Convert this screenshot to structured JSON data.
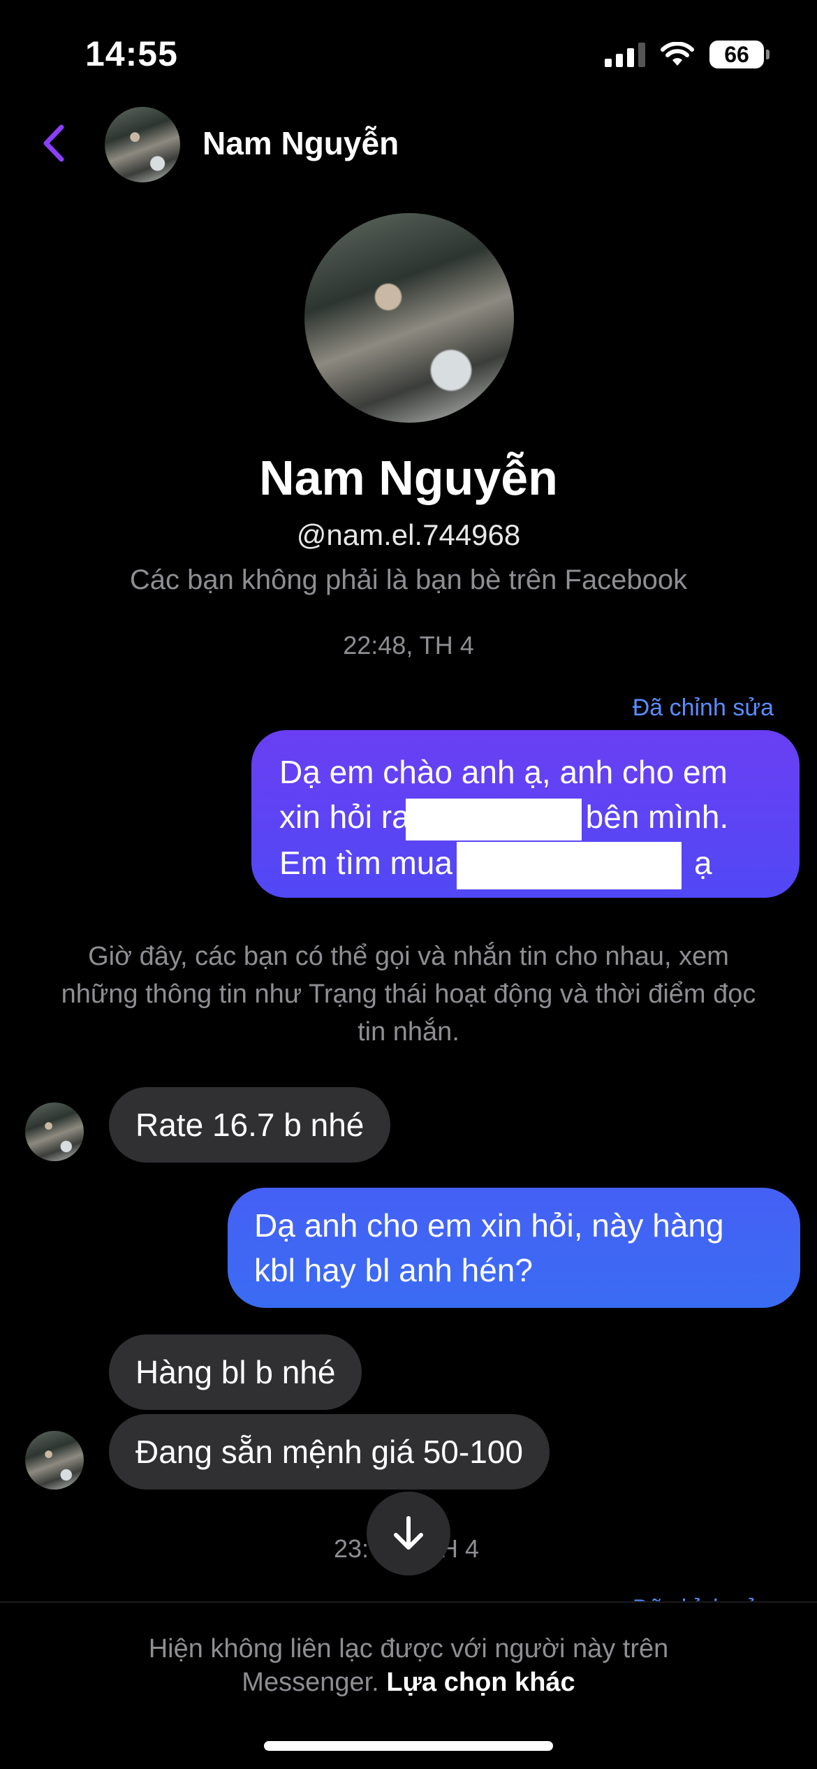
{
  "status_bar": {
    "time": "14:55",
    "battery": "66"
  },
  "header": {
    "name": "Nam Nguyễn",
    "back_icon": "chevron-left-icon"
  },
  "profile": {
    "name": "Nam Nguyễn",
    "handle": "@nam.el.744968",
    "note": "Các bạn không phải là bạn bè trên Facebook"
  },
  "conversation": {
    "timestamp_1": "22:48, TH 4",
    "edited_label": "Đã chỉnh sửa",
    "outgoing_1": {
      "line_1": "Dạ em chào anh ạ, anh cho em",
      "line_2_start": "xin hỏi ra",
      "line_2_end": "bên mình.",
      "line_3_start": "Em tìm mua",
      "line_3_end": "ạ"
    },
    "system_note": "Giờ đây, các bạn có thể gọi và nhắn tin cho nhau, xem những thông tin như Trạng thái hoạt động và thời điểm đọc tin nhắn.",
    "incoming_1": "Rate 16.7 b nhé",
    "outgoing_2": "Dạ anh cho em xin hỏi, này hàng kbl hay bl anh hén?",
    "incoming_2": "Hàng bl b nhé",
    "incoming_3": "Đang sẵn mệnh giá 50-100",
    "timestamp_2_left": "23:",
    "timestamp_2_right": "H 4"
  },
  "footer": {
    "text_line_1": "Hiện không liên lạc được với người này trên",
    "text_line_2": "Messenger.",
    "link": "Lựa chọn khác"
  },
  "colors": {
    "accent_purple": "#8a3ffc",
    "bubble_out_1": "#5b44f4",
    "bubble_out_2": "#3f66f4",
    "bubble_in": "#303033",
    "link_blue": "#5a8dff"
  }
}
